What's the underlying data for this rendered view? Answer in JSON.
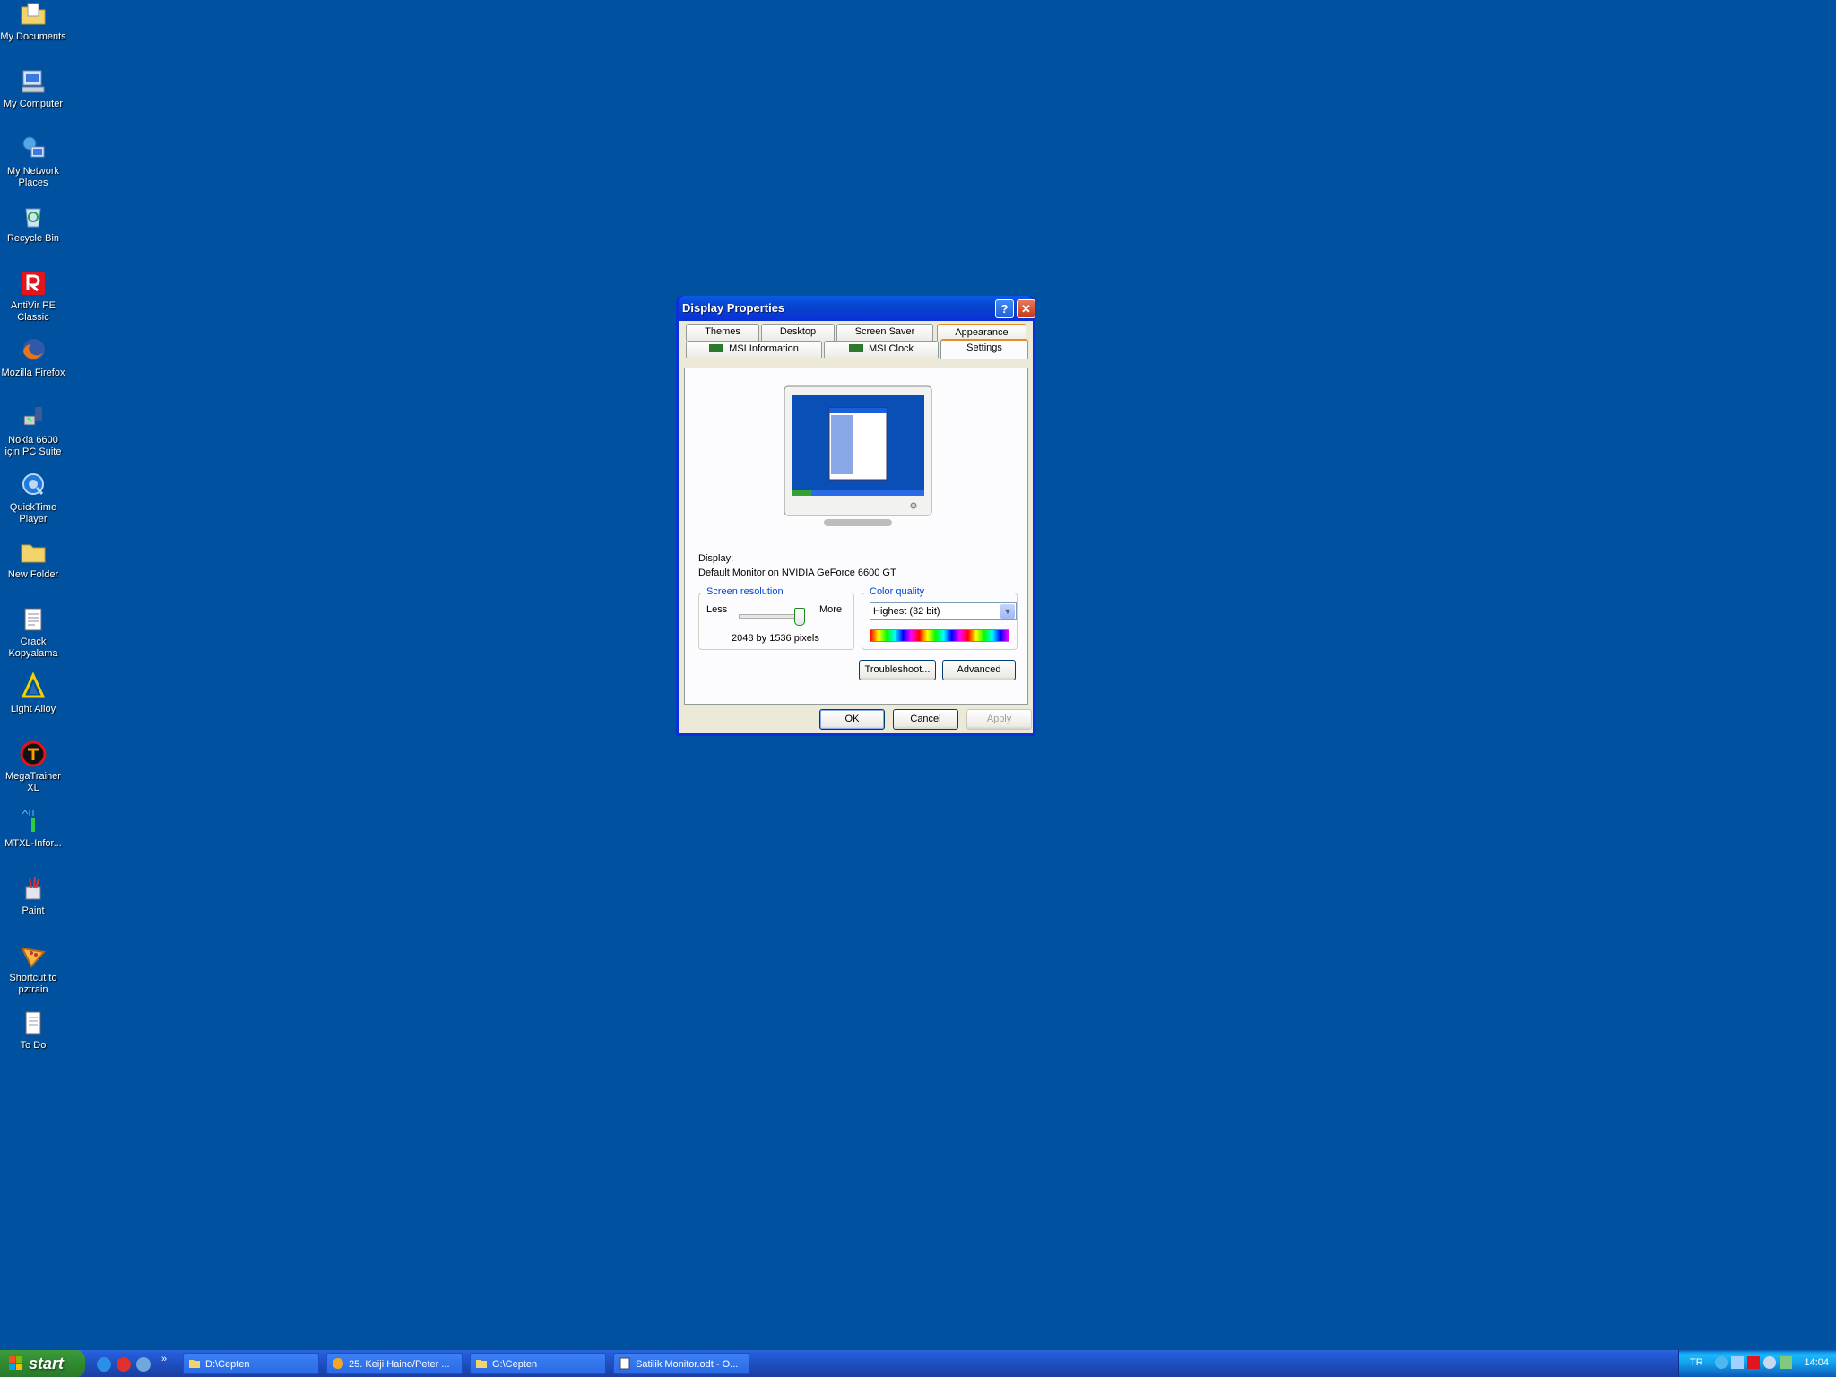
{
  "desktop": {
    "icons": [
      {
        "label": "My Documents",
        "icon": "folder-documents-icon"
      },
      {
        "label": "My Computer",
        "icon": "computer-icon"
      },
      {
        "label": "My Network Places",
        "icon": "network-icon"
      },
      {
        "label": "Recycle Bin",
        "icon": "recycle-bin-icon"
      },
      {
        "label": "AntiVir PE Classic",
        "icon": "antivir-icon"
      },
      {
        "label": "Mozilla Firefox",
        "icon": "firefox-icon"
      },
      {
        "label": "Nokia 6600 için PC Suite",
        "icon": "nokia-icon"
      },
      {
        "label": "QuickTime Player",
        "icon": "quicktime-icon"
      },
      {
        "label": "New Folder",
        "icon": "folder-icon"
      },
      {
        "label": "Crack Kopyalama",
        "icon": "notepad-icon"
      },
      {
        "label": "Light Alloy",
        "icon": "light-alloy-icon"
      },
      {
        "label": "MegaTrainer XL",
        "icon": "megatrainer-icon"
      },
      {
        "label": "MTXL-Infor...",
        "icon": "mtxl-icon"
      },
      {
        "label": "Paint",
        "icon": "paint-icon"
      },
      {
        "label": "Shortcut to pztrain",
        "icon": "pizza-icon"
      },
      {
        "label": "To Do",
        "icon": "text-file-icon"
      }
    ]
  },
  "dialog": {
    "title": "Display Properties",
    "help_label": "?",
    "close_label": "✕",
    "tabs_row1": [
      "Themes",
      "Desktop",
      "Screen Saver",
      "Appearance"
    ],
    "tabs_row2": [
      "MSI Information",
      "MSI Clock",
      "Settings"
    ],
    "active_tab": "Settings",
    "display_label": "Display:",
    "display_value": "Default Monitor on NVIDIA GeForce 6600 GT",
    "resolution": {
      "group_label": "Screen resolution",
      "less": "Less",
      "more": "More",
      "value_text": "2048 by 1536 pixels",
      "slider_level": 1.0
    },
    "color_quality": {
      "group_label": "Color quality",
      "selected": "Highest (32 bit)"
    },
    "buttons": {
      "troubleshoot": "Troubleshoot...",
      "advanced": "Advanced",
      "ok": "OK",
      "cancel": "Cancel",
      "apply": "Apply"
    }
  },
  "taskbar": {
    "start_label": "start",
    "overflow": "»",
    "tasks": [
      {
        "label": "D:\\Cepten",
        "icon": "folder-icon"
      },
      {
        "label": "25. Keiji Haino/Peter ...",
        "icon": "media-player-icon"
      },
      {
        "label": "G:\\Cepten",
        "icon": "folder-icon"
      },
      {
        "label": "Satilik Monitor.odt - O...",
        "icon": "document-icon"
      }
    ],
    "tray": {
      "language": "TR",
      "clock": "14:04"
    }
  },
  "colors": {
    "desktop_bg": "#00519f",
    "title_blue": "#0831d9",
    "dialog_bg": "#ece9d8",
    "group_label": "#0046d5",
    "start_green": "#2f8a2f"
  }
}
